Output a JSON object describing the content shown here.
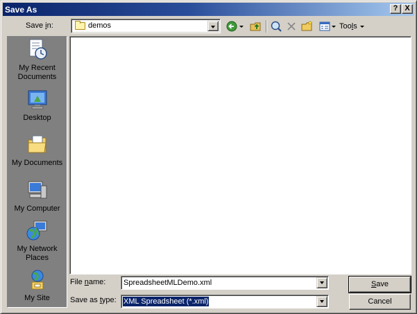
{
  "window": {
    "title": "Save As"
  },
  "titlebar": {
    "help_label": "?",
    "close_label": "X"
  },
  "save_in": {
    "label_pre": "Save ",
    "label_accel": "i",
    "label_post": "n:",
    "value": "demos",
    "icon": "folder-icon"
  },
  "toolbar": {
    "tools_pre": "Too",
    "tools_accel": "l",
    "tools_post": "s",
    "icons": [
      "back-icon",
      "up-folder-icon",
      "search-web-icon",
      "delete-icon",
      "new-folder-icon",
      "views-icon"
    ]
  },
  "places": [
    {
      "label": "My Recent Documents",
      "icon": "recent-documents-icon"
    },
    {
      "label": "Desktop",
      "icon": "desktop-icon"
    },
    {
      "label": "My Documents",
      "icon": "my-documents-icon"
    },
    {
      "label": "My Computer",
      "icon": "my-computer-icon"
    },
    {
      "label": "My Network Places",
      "icon": "network-places-icon"
    },
    {
      "label": "My Site",
      "icon": "my-site-icon"
    }
  ],
  "file_name": {
    "label_pre": "File ",
    "label_accel": "n",
    "label_post": "ame:",
    "value": "SpreadsheetMLDemo.xml"
  },
  "save_type": {
    "label_pre": "Save as ",
    "label_accel": "t",
    "label_post": "ype:",
    "value": "XML Spreadsheet (*.xml)"
  },
  "buttons": {
    "save_accel": "S",
    "save_rest": "ave",
    "cancel": "Cancel"
  },
  "colors": {
    "title_gradient_start": "#0a246a",
    "title_gradient_end": "#a6caf0",
    "face": "#d4d0c8",
    "selection": "#0a246a"
  }
}
